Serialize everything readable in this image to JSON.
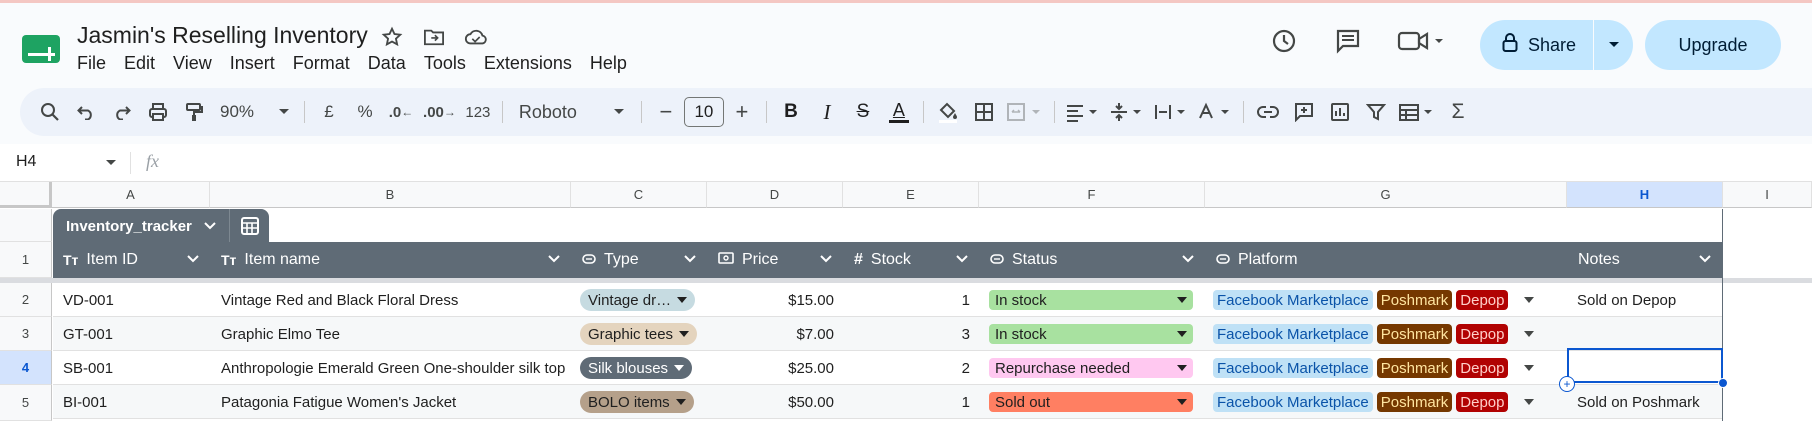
{
  "doc": {
    "title": "Jasmin's Reselling Inventory",
    "menu": [
      "File",
      "Edit",
      "View",
      "Insert",
      "Format",
      "Data",
      "Tools",
      "Extensions",
      "Help"
    ],
    "share_label": "Share",
    "upgrade_label": "Upgrade"
  },
  "toolbar": {
    "zoom": "90%",
    "currency": "£",
    "percent": "%",
    "dec_decrease": ".0",
    "dec_increase": ".00",
    "number_format": "123",
    "font": "Roboto",
    "font_size": "10",
    "minus": "−",
    "plus": "+",
    "bold": "B",
    "italic": "I",
    "strike": "S",
    "text_color": "A",
    "sum": "Σ"
  },
  "formula_bar": {
    "name_box": "H4",
    "fx": "fx"
  },
  "grid": {
    "columns": [
      "A",
      "B",
      "C",
      "D",
      "E",
      "F",
      "G",
      "H",
      "I"
    ],
    "rows": [
      "1",
      "2",
      "3",
      "4",
      "5"
    ],
    "selected_column": "H",
    "selected_row": "4"
  },
  "table": {
    "name": "Inventory_tracker",
    "headers": [
      {
        "icon": "Tт",
        "label": "Item ID"
      },
      {
        "icon": "Tт",
        "label": "Item name"
      },
      {
        "icon": "◌",
        "label": "Type"
      },
      {
        "icon": "▭",
        "label": "Price"
      },
      {
        "icon": "#",
        "label": "Stock"
      },
      {
        "icon": "◌",
        "label": "Status"
      },
      {
        "icon": "◌",
        "label": "Platform"
      },
      {
        "icon": "",
        "label": "Notes"
      }
    ],
    "rows": [
      {
        "id": "VD-001",
        "name": "Vintage Red and Black Floral Dress",
        "type": "Vintage dr…",
        "price": "$15.00",
        "stock": "1",
        "status": "In stock",
        "platforms": [
          "Facebook Marketplace",
          "Poshmark",
          "Depop"
        ],
        "notes": "Sold on Depop"
      },
      {
        "id": "GT-001",
        "name": "Graphic Elmo Tee",
        "type": "Graphic tees",
        "price": "$7.00",
        "stock": "3",
        "status": "In stock",
        "platforms": [
          "Facebook Marketplace",
          "Poshmark",
          "Depop"
        ],
        "notes": ""
      },
      {
        "id": "SB-001",
        "name": "Anthropologie Emerald Green One-shoulder silk top",
        "type": "Silk blouses",
        "price": "$25.00",
        "stock": "2",
        "status": "Repurchase needed",
        "platforms": [
          "Facebook Marketplace",
          "Poshmark",
          "Depop"
        ],
        "notes": ""
      },
      {
        "id": "BI-001",
        "name": "Patagonia Fatigue Women's Jacket",
        "type": "BOLO items",
        "price": "$50.00",
        "stock": "1",
        "status": "Sold out",
        "platforms": [
          "Facebook Marketplace",
          "Poshmark",
          "Depop"
        ],
        "notes": "Sold on Poshmark"
      }
    ]
  },
  "colors": {
    "type_vintage": "#c6dbe1",
    "type_graphic": "#e6cff2",
    "type_silk": "#5f6b76",
    "type_bolo": "#b5a08a",
    "status_instock": "#a8e1a0",
    "status_repurchase": "#ffc8f0",
    "status_soldout": "#ff7f62",
    "plat_facebook": "#bfe1f6",
    "plat_poshmark": "#753800",
    "plat_depop": "#b10202",
    "accent": "#0b57d0"
  }
}
